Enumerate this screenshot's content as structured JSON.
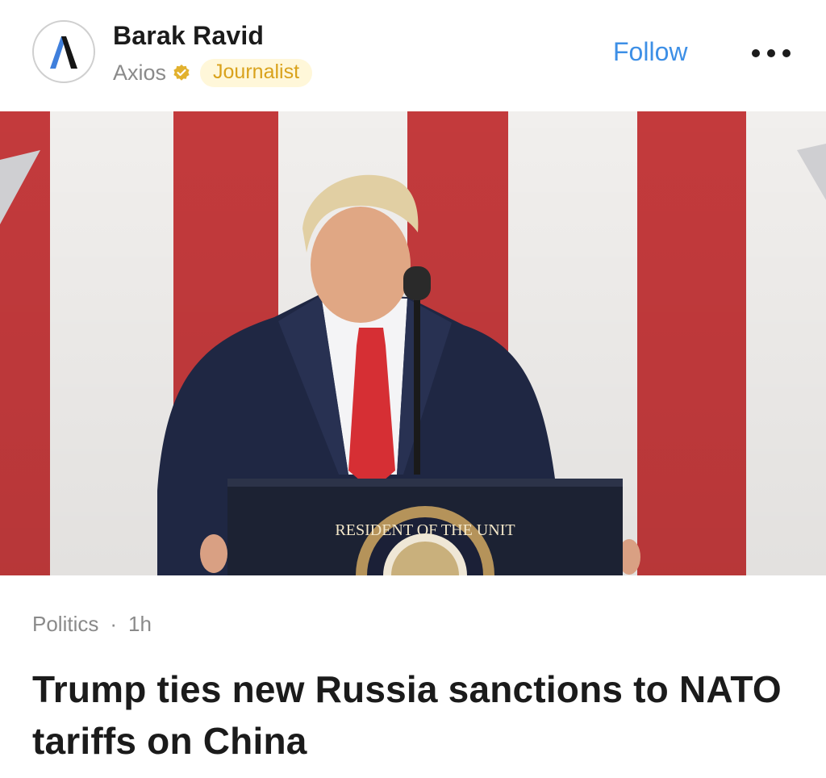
{
  "author": {
    "name": "Barak Ravid",
    "publisher": "Axios",
    "role_badge": "Journalist",
    "verified": true
  },
  "actions": {
    "follow_label": "Follow",
    "more_icon": "ellipsis-icon"
  },
  "article": {
    "category": "Politics",
    "separator": "·",
    "time_ago": "1h",
    "headline": "Trump ties new Russia sanctions to NATO tariffs on China",
    "seal_text": "RESIDENT OF THE UNIT"
  },
  "colors": {
    "follow": "#3d8fe6",
    "badge_text": "#d9a21c",
    "badge_bg": "#fff7d9",
    "verified": "#e2b12e",
    "flag_red": "#c33a3c",
    "flag_white": "#f1efed",
    "suit": "#1f2743",
    "tie": "#d62f34"
  }
}
